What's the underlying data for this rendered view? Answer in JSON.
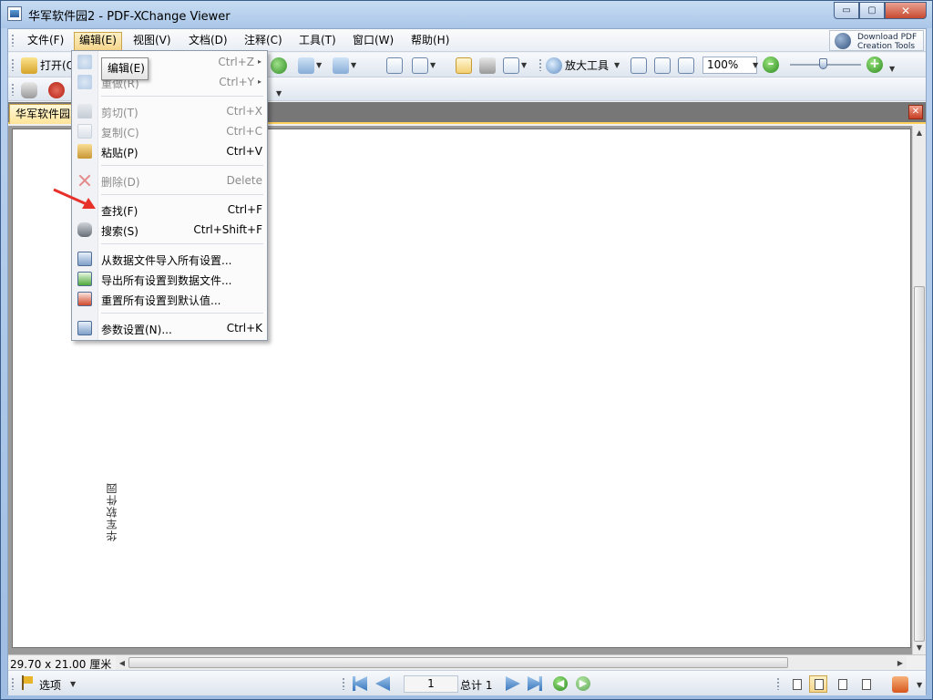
{
  "window": {
    "title": "华军软件园2 - PDF-XChange Viewer",
    "min_symbol": "▭",
    "max_symbol": "▢",
    "close_symbol": "✕"
  },
  "menubar": {
    "items": [
      "文件(F)",
      "编辑(E)",
      "视图(V)",
      "文档(D)",
      "注释(C)",
      "工具(T)",
      "窗口(W)",
      "帮助(H)"
    ],
    "active_index": 1,
    "promo_line1": "Download PDF",
    "promo_line2": "Creation Tools"
  },
  "toolbar1": {
    "open_label": "打开(O",
    "zoom_tool_label": "放大工具",
    "zoom_value": "100%",
    "zoom_minus": "–",
    "zoom_plus": "+"
  },
  "tabs": {
    "doc_tab_label": "华军软件园2",
    "close_symbol": "✕"
  },
  "edit_menu": {
    "tooltip": "编辑(E)",
    "undo_shortcut": "Ctrl+Z",
    "redo_label": "重做(R)",
    "redo_shortcut": "Ctrl+Y",
    "cut_label": "剪切(T)",
    "cut_shortcut": "Ctrl+X",
    "copy_label": "复制(C)",
    "copy_shortcut": "Ctrl+C",
    "paste_label": "粘贴(P)",
    "paste_shortcut": "Ctrl+V",
    "delete_label": "删除(D)",
    "delete_shortcut": "Delete",
    "find_label": "查找(F)",
    "find_shortcut": "Ctrl+F",
    "search_label": "搜索(S)",
    "search_shortcut": "Ctrl+Shift+F",
    "import_label": "从数据文件导入所有设置...",
    "export_label": "导出所有设置到数据文件...",
    "reset_label": "重置所有设置到默认值...",
    "prefs_label": "参数设置(N)...",
    "prefs_shortcut": "Ctrl+K",
    "submenu_arrow": "▸"
  },
  "document": {
    "vertical_text": "华军软件园"
  },
  "status": {
    "page_size": "29.70 x 21.00 厘米"
  },
  "navbar": {
    "options_label": "选项",
    "current_page": "1",
    "total_pages_label": "总计 1"
  },
  "colors": {
    "menu_highlight": "#f5d58a",
    "annotation_arrow": "#e8302b",
    "titlebar": "#bcd3ef"
  }
}
